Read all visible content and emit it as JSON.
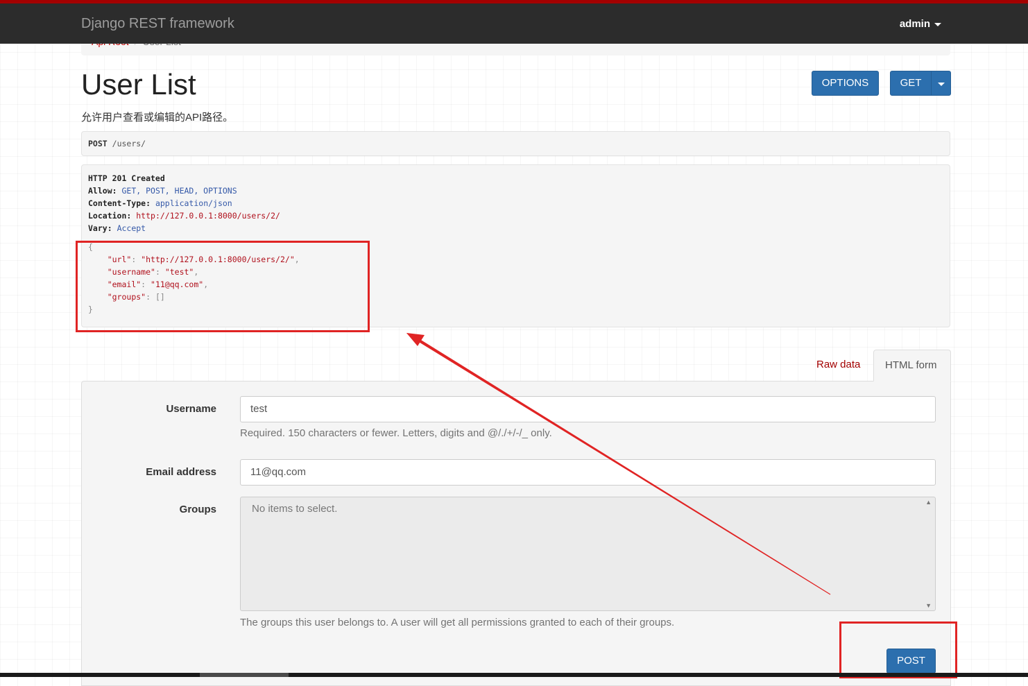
{
  "navbar": {
    "brand": "Django REST framework",
    "user": "admin"
  },
  "breadcrumb": {
    "root": "Api Root",
    "separator": "/",
    "current": "User List"
  },
  "page": {
    "title": "User List",
    "description": "允许用户查看或编辑的API路径。"
  },
  "actions": {
    "options_label": "OPTIONS",
    "get_label": "GET"
  },
  "request": {
    "method": "POST",
    "path": "/users/"
  },
  "response": {
    "status": "HTTP 201 Created",
    "headers": [
      {
        "key": "Allow:",
        "value": "GET, POST, HEAD, OPTIONS",
        "style": "hv"
      },
      {
        "key": "Content-Type:",
        "value": "application/json",
        "style": "hv"
      },
      {
        "key": "Location:",
        "value": "http://127.0.0.1:8000/users/2/",
        "style": "hlink"
      },
      {
        "key": "Vary:",
        "value": "Accept",
        "style": "hv"
      }
    ],
    "json_open": "{",
    "json_close": "}",
    "fields": [
      {
        "key": "\"url\"",
        "value": "\"http://127.0.0.1:8000/users/2/\"",
        "trail": ","
      },
      {
        "key": "\"username\"",
        "value": "\"test\"",
        "trail": ","
      },
      {
        "key": "\"email\"",
        "value": "\"11@qq.com\"",
        "trail": ","
      },
      {
        "key": "\"groups\"",
        "value": "[]",
        "trail": ""
      }
    ]
  },
  "tabs": {
    "raw": "Raw data",
    "html": "HTML form"
  },
  "form": {
    "username": {
      "label": "Username",
      "value": "test",
      "help": "Required. 150 characters or fewer. Letters, digits and @/./+/-/_ only."
    },
    "email": {
      "label": "Email address",
      "value": "11@qq.com"
    },
    "groups": {
      "label": "Groups",
      "empty_text": "No items to select.",
      "help": "The groups this user belongs to. A user will get all permissions granted to each of their groups."
    },
    "submit_label": "POST"
  },
  "colors": {
    "accent": "#2c6fae",
    "navbar": "#2c2c2c",
    "brand_line": "#a30000",
    "annotation": "#e02424"
  }
}
